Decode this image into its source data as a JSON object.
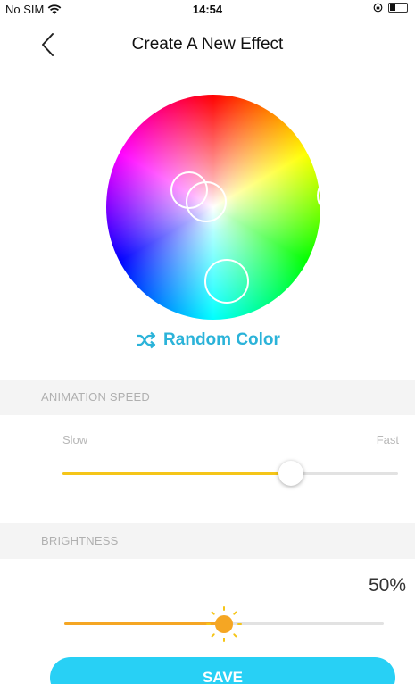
{
  "status_bar": {
    "carrier": "No SIM",
    "time": "14:54"
  },
  "nav": {
    "title": "Create A New Effect"
  },
  "random_color": {
    "label": "Random Color"
  },
  "animation_speed": {
    "header": "ANIMATION SPEED",
    "min_label": "Slow",
    "max_label": "Fast",
    "value_fraction": 0.68
  },
  "brightness": {
    "header": "BRIGHTNESS",
    "value": "50%",
    "value_fraction": 0.5
  },
  "save": {
    "label": "SAVE"
  },
  "colors": {
    "accent": "#2bb3d9",
    "save_button": "#28d0f5",
    "speed_fill": "#f5c518",
    "brightness_fill": "#f5a623",
    "section_bg": "#f4f4f4"
  }
}
